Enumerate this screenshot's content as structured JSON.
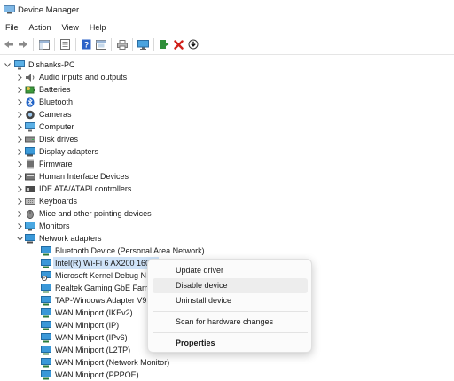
{
  "window": {
    "title": "Device Manager"
  },
  "menu": [
    "File",
    "Action",
    "View",
    "Help"
  ],
  "tree": {
    "root": "Dishanks-PC",
    "categories": [
      {
        "label": "Audio inputs and outputs",
        "icon": "speaker-icon"
      },
      {
        "label": "Batteries",
        "icon": "battery-icon"
      },
      {
        "label": "Bluetooth",
        "icon": "bluetooth-icon"
      },
      {
        "label": "Cameras",
        "icon": "camera-icon"
      },
      {
        "label": "Computer",
        "icon": "computer-icon"
      },
      {
        "label": "Disk drives",
        "icon": "disk-icon"
      },
      {
        "label": "Display adapters",
        "icon": "display-icon"
      },
      {
        "label": "Firmware",
        "icon": "chip-icon"
      },
      {
        "label": "Human Interface Devices",
        "icon": "hid-icon"
      },
      {
        "label": "IDE ATA/ATAPI controllers",
        "icon": "controller-icon"
      },
      {
        "label": "Keyboards",
        "icon": "keyboard-icon"
      },
      {
        "label": "Mice and other pointing devices",
        "icon": "mouse-icon"
      },
      {
        "label": "Monitors",
        "icon": "monitor-icon"
      },
      {
        "label": "Network adapters",
        "icon": "network-icon"
      }
    ],
    "network_children": [
      "Bluetooth Device (Personal Area Network)",
      "Intel(R) Wi-Fi 6 AX200 160M",
      "Microsoft Kernel Debug N",
      "Realtek Gaming GbE Famil",
      "TAP-Windows Adapter V9",
      "WAN Miniport (IKEv2)",
      "WAN Miniport (IP)",
      "WAN Miniport (IPv6)",
      "WAN Miniport (L2TP)",
      "WAN Miniport (Network Monitor)",
      "WAN Miniport (PPPOE)"
    ]
  },
  "context_menu": {
    "update": "Update driver",
    "disable": "Disable device",
    "uninstall": "Uninstall device",
    "scan": "Scan for hardware changes",
    "properties": "Properties"
  },
  "colors": {
    "selected": "#cfe3f8",
    "hover": "#ededed",
    "accent": "#0078d4",
    "delete": "#d0201a"
  }
}
